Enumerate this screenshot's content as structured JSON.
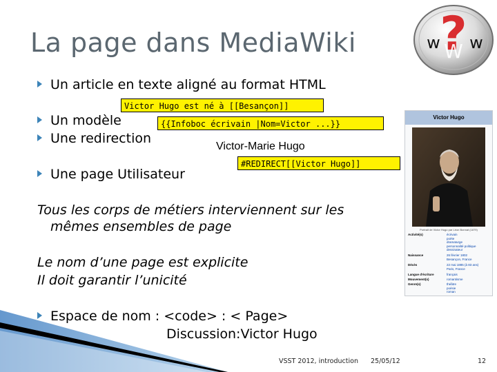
{
  "slide": {
    "title": "La page dans MediaWiki",
    "logo": {
      "letters": [
        "w",
        "W",
        "w"
      ],
      "icon": "question-mark-icon"
    },
    "bullets": [
      "Un article en texte aligné au format HTML",
      "Un modèle",
      "Une redirection",
      "Une page Utilisateur"
    ],
    "italic_lines": [
      "Tous les corps de métiers interviennent sur les",
      "mêmes ensembles de page",
      "Le nom d’une page est explicite",
      "Il doit garantir l’unicité"
    ],
    "namespace_bullet": "Espace de nom : <code> : < Page>",
    "namespace_example": "Discussion:Victor Hugo",
    "callouts": {
      "article": "Victor Hugo est né à [[Besançon]]",
      "template": "{{Infoboc écrivain |Nom=Victor ...}}",
      "redirect_title": "Victor-Marie Hugo",
      "redirect": "#REDIRECT[[Victor Hugo]]"
    },
    "infobox": {
      "title": "Victor Hugo",
      "caption": "Portrait de Victor Hugo par Léon Bonnat (1879)",
      "rows": [
        {
          "key": "Activité(s)",
          "values": [
            "écrivain",
            "poète",
            "dramaturge",
            "personnalité politique",
            "dessinateur"
          ]
        },
        {
          "key": "Naissance",
          "values": [
            "26 février 1802",
            "Besançon, France"
          ]
        },
        {
          "key": "Décès",
          "values": [
            "22 mai 1885 (à 83 ans)",
            "Paris, France"
          ]
        },
        {
          "key": "Langue d'écriture",
          "values": [
            "français"
          ]
        },
        {
          "key": "Mouvement(s)",
          "values": [
            "romantisme"
          ]
        },
        {
          "key": "Genre(s)",
          "values": [
            "théâtre",
            "poésie",
            "roman"
          ]
        }
      ]
    },
    "footer": {
      "left": "VSST 2012, introduction",
      "date": "25/05/12",
      "page": "12"
    },
    "colors": {
      "title": "#5b6770",
      "bullet_marker": "#3d84b8",
      "callout_bg": "#fff200",
      "infobox_header": "#b0c4de",
      "logo_question_mark": "#d7191c"
    }
  }
}
